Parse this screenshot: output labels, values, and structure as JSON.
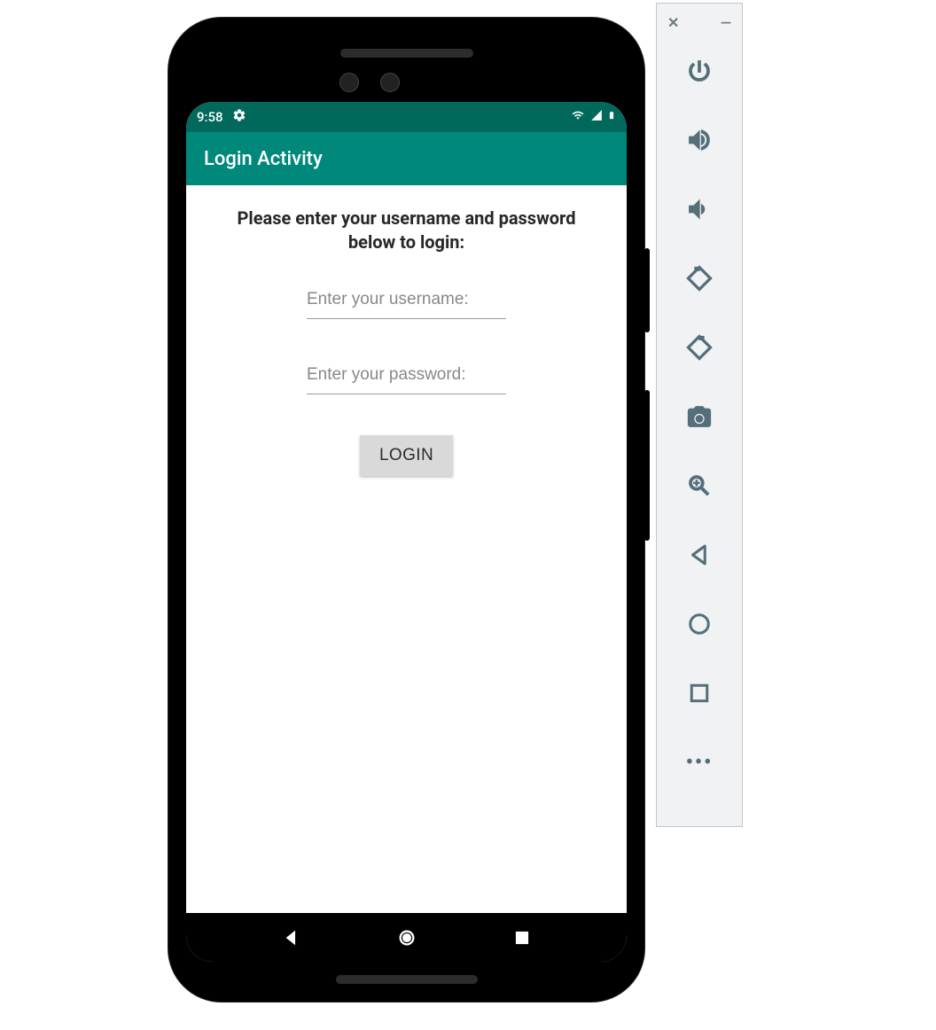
{
  "status_bar": {
    "time": "9:58"
  },
  "title_bar": {
    "title": "Login Activity"
  },
  "content": {
    "instruction": "Please enter your username and password below to login:",
    "username_placeholder": "Enter your username:",
    "password_placeholder": "Enter your password:",
    "login_label": "LOGIN"
  }
}
